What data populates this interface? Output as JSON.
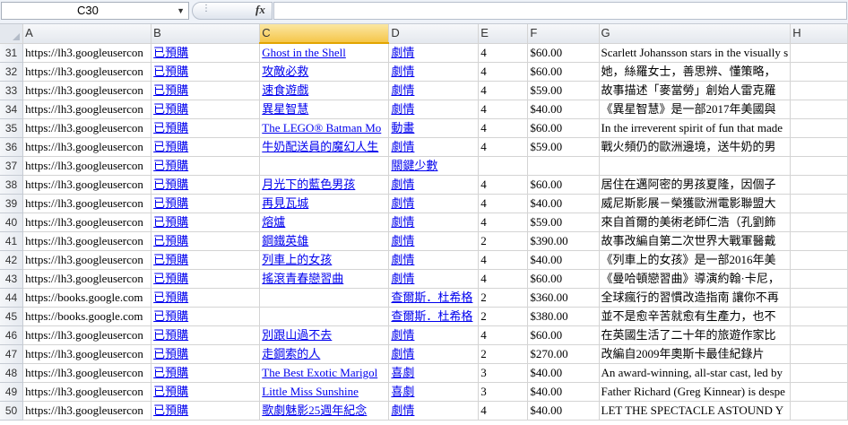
{
  "formula_bar": {
    "name_box": "C30",
    "fx_label": "fx",
    "formula": ""
  },
  "columns": [
    "A",
    "B",
    "C",
    "D",
    "E",
    "F",
    "G",
    "H"
  ],
  "active_column": "C",
  "rows": [
    {
      "n": "31",
      "a": "https://lh3.googleusercon",
      "b": "已預購",
      "c": "Ghost in the Shell",
      "d": "劇情",
      "e": "4",
      "f": "$60.00",
      "g": "Scarlett Johansson stars in the visually s"
    },
    {
      "n": "32",
      "a": "https://lh3.googleusercon",
      "b": "已預購",
      "c": "攻敵必救",
      "d": "劇情",
      "e": "4",
      "f": "$60.00",
      "g": "她，絲羅女士，善思辨、懂策略，"
    },
    {
      "n": "33",
      "a": "https://lh3.googleusercon",
      "b": "已預購",
      "c": "速食遊戲",
      "d": "劇情",
      "e": "4",
      "f": "$59.00",
      "g": "故事描述「麥當勞」創始人雷克羅"
    },
    {
      "n": "34",
      "a": "https://lh3.googleusercon",
      "b": "已預購",
      "c": "異星智慧",
      "d": "劇情",
      "e": "4",
      "f": "$40.00",
      "g": "《異星智慧》是一部2017年美國與"
    },
    {
      "n": "35",
      "a": "https://lh3.googleusercon",
      "b": "已預購",
      "c": "The LEGO® Batman Mo",
      "d": "動畫",
      "e": "4",
      "f": "$60.00",
      "g": "In the irreverent spirit of fun that made"
    },
    {
      "n": "36",
      "a": "https://lh3.googleusercon",
      "b": "已預購",
      "c": "牛奶配送員的魔幻人生",
      "d": "劇情",
      "e": "4",
      "f": "$59.00",
      "g": "戰火頻仍的歐洲邊境，送牛奶的男"
    },
    {
      "n": "37",
      "a": "https://lh3.googleusercon",
      "b": "已預購",
      "c": "",
      "d": "關鍵少數",
      "e": "",
      "f": "",
      "g": ""
    },
    {
      "n": "38",
      "a": "https://lh3.googleusercon",
      "b": "已預購",
      "c": "月光下的藍色男孩",
      "d": "劇情",
      "e": "4",
      "f": "$60.00",
      "g": "居住在邁阿密的男孩夏隆，因個子"
    },
    {
      "n": "39",
      "a": "https://lh3.googleusercon",
      "b": "已預購",
      "c": "再見瓦城",
      "d": "劇情",
      "e": "4",
      "f": "$40.00",
      "g": "威尼斯影展－榮獲歐洲電影聯盟大"
    },
    {
      "n": "40",
      "a": "https://lh3.googleusercon",
      "b": "已預購",
      "c": "熔爐",
      "d": "劇情",
      "e": "4",
      "f": "$59.00",
      "g": "來自首爾的美術老師仁浩（孔劉飾"
    },
    {
      "n": "41",
      "a": "https://lh3.googleusercon",
      "b": "已預購",
      "c": "鋼鐵英雄",
      "d": "劇情",
      "e": "2",
      "f": "$390.00",
      "g": "故事改編自第二次世界大戰軍醫戴"
    },
    {
      "n": "42",
      "a": "https://lh3.googleusercon",
      "b": "已預購",
      "c": "列車上的女孩",
      "d": "劇情",
      "e": "4",
      "f": "$40.00",
      "g": "《列車上的女孩》是一部2016年美"
    },
    {
      "n": "43",
      "a": "https://lh3.googleusercon",
      "b": "已預購",
      "c": "搖滾青春戀習曲",
      "d": "劇情",
      "e": "4",
      "f": "$60.00",
      "g": "《曼哈頓戀習曲》導演約翰·卡尼，"
    },
    {
      "n": "44",
      "a": "https://books.google.com",
      "b": "已預購",
      "c": "",
      "d": "查爾斯．杜希格",
      "e": "2",
      "f": "$360.00",
      "g": "全球瘋行的習慣改造指南 讓你不再"
    },
    {
      "n": "45",
      "a": "https://books.google.com",
      "b": "已預購",
      "c": "",
      "d": "查爾斯．杜希格",
      "e": "2",
      "f": "$380.00",
      "g": "並不是愈辛苦就愈有生產力，也不"
    },
    {
      "n": "46",
      "a": "https://lh3.googleusercon",
      "b": "已預購",
      "c": "別跟山過不去",
      "d": "劇情",
      "e": "4",
      "f": "$60.00",
      "g": "在英國生活了二十年的旅遊作家比"
    },
    {
      "n": "47",
      "a": "https://lh3.googleusercon",
      "b": "已預購",
      "c": "走鋼索的人",
      "d": "劇情",
      "e": "2",
      "f": "$270.00",
      "g": "改編自2009年奧斯卡最佳紀錄片"
    },
    {
      "n": "48",
      "a": "https://lh3.googleusercon",
      "b": "已預購",
      "c": "The Best Exotic Marigol",
      "d": "喜劇",
      "e": "3",
      "f": "$40.00",
      "g": "An award-winning, all-star cast, led by"
    },
    {
      "n": "49",
      "a": "https://lh3.googleusercon",
      "b": "已預購",
      "c": "Little Miss Sunshine",
      "d": "喜劇",
      "e": "3",
      "f": "$40.00",
      "g": "Father Richard (Greg Kinnear) is despe"
    },
    {
      "n": "50",
      "a": "https://lh3.googleusercon",
      "b": "已預購",
      "c": "歌劇魅影25週年紀念",
      "d": "劇情",
      "e": "4",
      "f": "$40.00",
      "g": "LET THE SPECTACLE ASTOUND Y"
    }
  ]
}
